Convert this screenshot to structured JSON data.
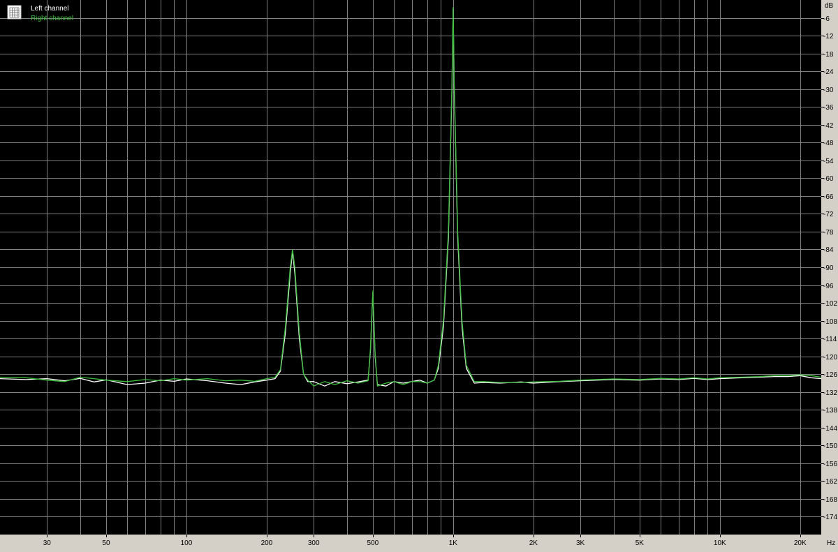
{
  "chart_data": {
    "type": "line",
    "x_scale": "log",
    "xlim": [
      20,
      24000
    ],
    "ylim": [
      -180,
      0
    ],
    "xlabel": "Hz",
    "ylabel": "dB",
    "grid": true,
    "legend_position": "top-left",
    "x_ticks": [
      {
        "value": 30,
        "label": "30"
      },
      {
        "value": 50,
        "label": "50"
      },
      {
        "value": 100,
        "label": "100"
      },
      {
        "value": 200,
        "label": "200"
      },
      {
        "value": 300,
        "label": "300"
      },
      {
        "value": 500,
        "label": "500"
      },
      {
        "value": 1000,
        "label": "1K"
      },
      {
        "value": 2000,
        "label": "2K"
      },
      {
        "value": 3000,
        "label": "3K"
      },
      {
        "value": 5000,
        "label": "5K"
      },
      {
        "value": 10000,
        "label": "10K"
      },
      {
        "value": 20000,
        "label": "20K"
      }
    ],
    "y_ticks": [
      -6,
      -12,
      -18,
      -24,
      -30,
      -36,
      -42,
      -48,
      -54,
      -60,
      -66,
      -72,
      -78,
      -84,
      -90,
      -96,
      -102,
      -108,
      -114,
      -120,
      -126,
      -132,
      -138,
      -144,
      -150,
      -156,
      -162,
      -168,
      -174
    ],
    "series": [
      {
        "name": "Left channel",
        "color": "#ffffff",
        "points": [
          [
            20,
            -127.5
          ],
          [
            25,
            -127.8
          ],
          [
            30,
            -127.5
          ],
          [
            35,
            -128.2
          ],
          [
            40,
            -127.4
          ],
          [
            45,
            -128.6
          ],
          [
            50,
            -127.9
          ],
          [
            60,
            -129.5
          ],
          [
            70,
            -129.0
          ],
          [
            80,
            -128.0
          ],
          [
            90,
            -128.4
          ],
          [
            100,
            -127.6
          ],
          [
            120,
            -128.2
          ],
          [
            140,
            -129.0
          ],
          [
            160,
            -129.5
          ],
          [
            180,
            -128.6
          ],
          [
            200,
            -128.0
          ],
          [
            215,
            -127.5
          ],
          [
            225,
            -125.0
          ],
          [
            235,
            -112.0
          ],
          [
            245,
            -92.0
          ],
          [
            250,
            -84.5
          ],
          [
            255,
            -92.0
          ],
          [
            265,
            -114.0
          ],
          [
            275,
            -126.0
          ],
          [
            285,
            -128.5
          ],
          [
            300,
            -128.5
          ],
          [
            330,
            -130.0
          ],
          [
            360,
            -128.5
          ],
          [
            400,
            -129.2
          ],
          [
            440,
            -128.6
          ],
          [
            480,
            -128.0
          ],
          [
            490,
            -118.0
          ],
          [
            500,
            -98.5
          ],
          [
            510,
            -120.0
          ],
          [
            520,
            -129.5
          ],
          [
            560,
            -130.0
          ],
          [
            600,
            -128.5
          ],
          [
            650,
            -129.0
          ],
          [
            700,
            -128.5
          ],
          [
            750,
            -128.0
          ],
          [
            800,
            -129.0
          ],
          [
            850,
            -128.0
          ],
          [
            880,
            -124.0
          ],
          [
            920,
            -110.0
          ],
          [
            960,
            -80.0
          ],
          [
            990,
            -30.0
          ],
          [
            1000,
            -3.0
          ],
          [
            1010,
            -30.0
          ],
          [
            1040,
            -80.0
          ],
          [
            1080,
            -110.0
          ],
          [
            1120,
            -124.0
          ],
          [
            1200,
            -129.0
          ],
          [
            1300,
            -128.8
          ],
          [
            1500,
            -129.0
          ],
          [
            1800,
            -128.6
          ],
          [
            2000,
            -129.0
          ],
          [
            2500,
            -128.5
          ],
          [
            3000,
            -128.2
          ],
          [
            4000,
            -127.8
          ],
          [
            5000,
            -128.0
          ],
          [
            6000,
            -127.6
          ],
          [
            7000,
            -127.8
          ],
          [
            8000,
            -127.4
          ],
          [
            9000,
            -127.8
          ],
          [
            10000,
            -127.5
          ],
          [
            12000,
            -127.2
          ],
          [
            14000,
            -127.0
          ],
          [
            16000,
            -126.8
          ],
          [
            18000,
            -126.8
          ],
          [
            20000,
            -126.5
          ],
          [
            22000,
            -127.2
          ],
          [
            24000,
            -127.5
          ]
        ]
      },
      {
        "name": "Right channel",
        "color": "#3cbe3c",
        "points": [
          [
            20,
            -127.0
          ],
          [
            25,
            -127.2
          ],
          [
            30,
            -128.0
          ],
          [
            35,
            -128.5
          ],
          [
            40,
            -127.0
          ],
          [
            45,
            -127.5
          ],
          [
            50,
            -128.0
          ],
          [
            60,
            -128.5
          ],
          [
            70,
            -127.8
          ],
          [
            80,
            -128.2
          ],
          [
            90,
            -127.5
          ],
          [
            100,
            -128.0
          ],
          [
            120,
            -127.5
          ],
          [
            140,
            -128.2
          ],
          [
            160,
            -128.0
          ],
          [
            180,
            -128.4
          ],
          [
            200,
            -127.5
          ],
          [
            215,
            -127.0
          ],
          [
            225,
            -124.5
          ],
          [
            235,
            -110.0
          ],
          [
            245,
            -90.0
          ],
          [
            250,
            -84.0
          ],
          [
            255,
            -90.0
          ],
          [
            265,
            -112.0
          ],
          [
            275,
            -126.0
          ],
          [
            285,
            -128.0
          ],
          [
            300,
            -130.0
          ],
          [
            330,
            -128.5
          ],
          [
            360,
            -129.5
          ],
          [
            400,
            -128.2
          ],
          [
            440,
            -129.0
          ],
          [
            480,
            -128.2
          ],
          [
            490,
            -117.0
          ],
          [
            500,
            -98.0
          ],
          [
            510,
            -119.0
          ],
          [
            520,
            -130.0
          ],
          [
            560,
            -129.0
          ],
          [
            600,
            -128.5
          ],
          [
            650,
            -129.5
          ],
          [
            700,
            -128.5
          ],
          [
            750,
            -128.5
          ],
          [
            800,
            -129.0
          ],
          [
            850,
            -128.0
          ],
          [
            880,
            -123.0
          ],
          [
            920,
            -108.0
          ],
          [
            960,
            -78.0
          ],
          [
            990,
            -28.0
          ],
          [
            1000,
            -2.5
          ],
          [
            1010,
            -28.0
          ],
          [
            1040,
            -78.0
          ],
          [
            1080,
            -108.0
          ],
          [
            1120,
            -123.0
          ],
          [
            1200,
            -128.5
          ],
          [
            1300,
            -128.5
          ],
          [
            1500,
            -128.8
          ],
          [
            1800,
            -128.8
          ],
          [
            2000,
            -128.6
          ],
          [
            2500,
            -128.4
          ],
          [
            3000,
            -128.0
          ],
          [
            4000,
            -127.6
          ],
          [
            5000,
            -127.8
          ],
          [
            6000,
            -127.4
          ],
          [
            7000,
            -127.6
          ],
          [
            8000,
            -127.2
          ],
          [
            9000,
            -127.6
          ],
          [
            10000,
            -127.2
          ],
          [
            12000,
            -127.0
          ],
          [
            14000,
            -126.8
          ],
          [
            16000,
            -126.5
          ],
          [
            18000,
            -126.5
          ],
          [
            20000,
            -126.2
          ],
          [
            22000,
            -126.5
          ],
          [
            24000,
            -127.0
          ]
        ]
      }
    ]
  }
}
